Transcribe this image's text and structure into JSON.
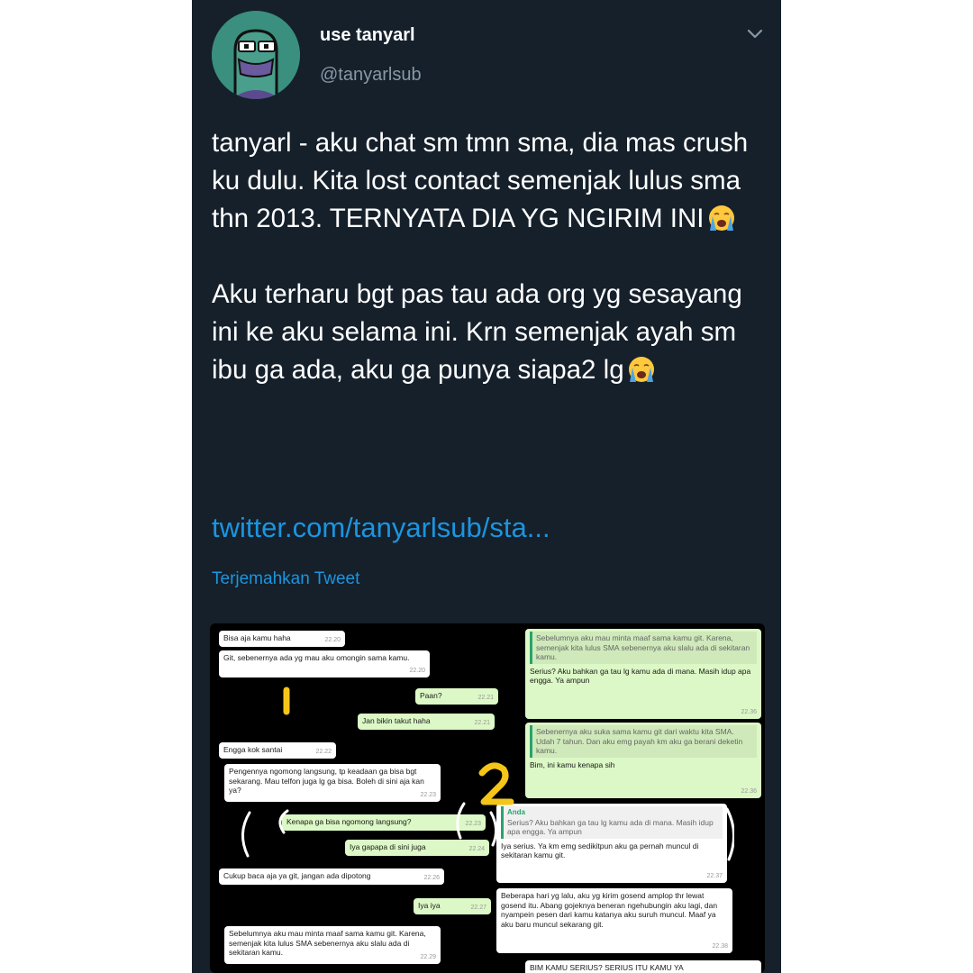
{
  "account": {
    "display_name": "use tanyarl",
    "handle": "@tanyarlsub"
  },
  "tweet": {
    "paragraph1": "tanyarl - aku chat sm tmn sma, dia mas crush ku dulu. Kita lost contact semenjak lulus sma thn 2013. TERNYATA DIA YG NGIRIM INI",
    "paragraph2": "Aku terharu bgt pas tau ada org yg sesayang ini ke aku selama ini. Krn semenjak ayah sm ibu ga ada, aku ga punya siapa2 lg",
    "link": "twitter.com/tanyarlsub/sta...",
    "translate_label": "Terjemahkan Tweet",
    "emoji": "loudly-crying-face"
  },
  "chat_left": [
    {
      "text": "Bisa aja kamu haha",
      "time": "22.20"
    },
    {
      "text": "Git, sebenernya ada yg mau aku omongin sama kamu.",
      "time": "22.20"
    },
    {
      "text": "Paan?",
      "time": "22.21"
    },
    {
      "text": "Jan bikin takut haha",
      "time": "22.21"
    },
    {
      "text": "Engga kok santai",
      "time": "22.22"
    },
    {
      "text": "Pengennya ngomong langsung, tp keadaan ga bisa bgt sekarang. Mau telfon juga lg ga bisa. Boleh di sini aja kan ya?",
      "time": "22.23"
    },
    {
      "text": "Kenapa ga bisa ngomong langsung?",
      "time": "22.23"
    },
    {
      "text": "Iya gapapa di sini juga",
      "time": "22.24"
    },
    {
      "text": "Cukup baca aja ya git, jangan ada dipotong",
      "time": "22.26"
    },
    {
      "text": "Iya iya",
      "time": "22.27"
    },
    {
      "text": "Sebelumnya aku mau minta maaf sama kamu git. Karena, semenjak kita lulus SMA sebenernya aku slalu ada di sekitaran kamu.",
      "time": "22.29"
    }
  ],
  "chat_right": [
    {
      "quote": "Sebelumnya aku mau minta maaf sama kamu git. Karena, semenjak kita lulus SMA sebenernya aku slalu ada di sekitaran kamu.",
      "text": "Serius? Aku bahkan ga tau lg kamu ada di mana. Masih idup apa engga. Ya ampun",
      "time": "22.36"
    },
    {
      "quote": "Sebenernya aku suka sama kamu git dari waktu kita SMA. Udah 7 tahun. Dan aku emg payah km aku ga berani deketin kamu.",
      "text": "Bim, ini kamu kenapa sih",
      "time": "22.36"
    },
    {
      "quote_label": "Anda",
      "quote": "Serius? Aku bahkan ga tau lg kamu ada di mana. Masih idup apa engga. Ya ampun",
      "text": "Iya serius. Ya km emg sedikitpun aku ga pernah muncul di sekitaran kamu git.",
      "time": "22.37"
    },
    {
      "text": "Beberapa hari yg lalu, aku yg kirim gosend amplop thr lewat gosend itu. Abang gojeknya beneran ngehubungin aku lagi, dan nyampein pesen dari kamu katanya aku suruh muncul. Maaf ya aku baru muncul sekarang git.",
      "time": "22.38"
    },
    {
      "text": "BIM KAMU SERIUS? SERIUS ITU KAMU YA"
    }
  ],
  "annotations": {
    "marker_1": "1",
    "marker_2": "2"
  },
  "colors": {
    "background": "#15202b",
    "link": "#1b95e0",
    "outgoing_bubble": "#dcf8c6",
    "annotation": "#f5c518"
  }
}
